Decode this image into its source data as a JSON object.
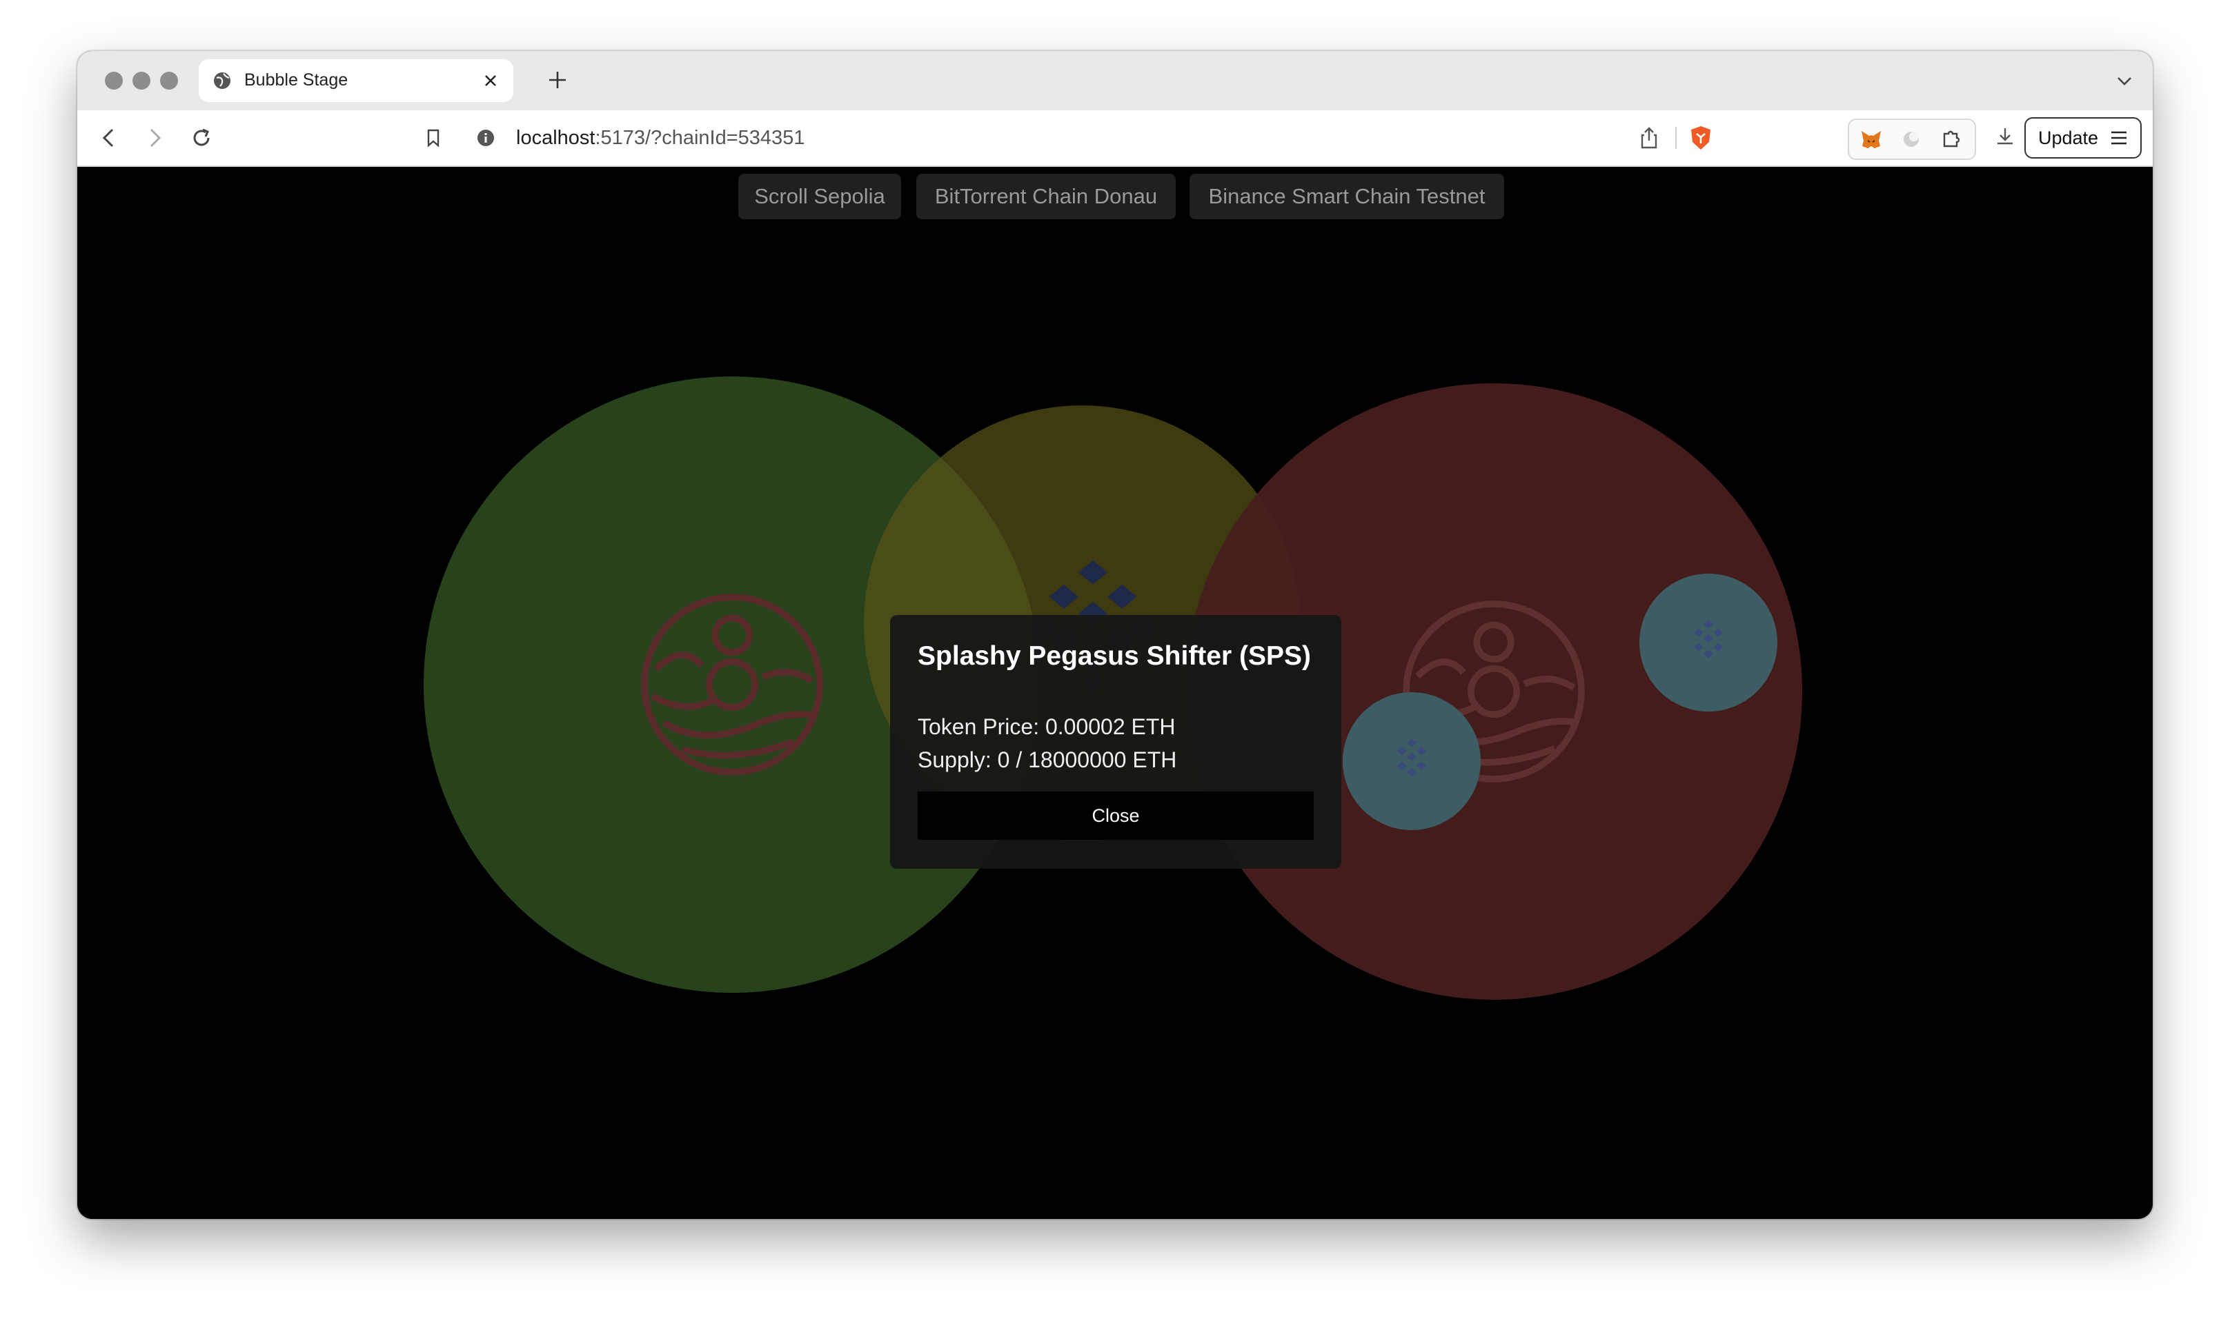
{
  "browser": {
    "tab_title": "Bubble Stage",
    "url_host": "localhost",
    "url_rest": ":5173/?chainId=534351",
    "update_label": "Update"
  },
  "chains": [
    "Scroll Sepolia",
    "BitTorrent Chain Donau",
    "Binance Smart Chain Testnet"
  ],
  "bubbles": [
    {
      "name": "green-bubble",
      "color": "#2e4b1f",
      "icon": "orbit-token-icon"
    },
    {
      "name": "olive-bubble",
      "color": "#4f4a16",
      "icon": "hash-token-icon"
    },
    {
      "name": "red-bubble",
      "color": "#471d1d",
      "icon": "orbit-token-icon"
    },
    {
      "name": "small-teal-bubble",
      "color": "#3d5c63",
      "icon": "hash-token-icon"
    },
    {
      "name": "small-teal-bubble-2",
      "color": "#3d5c63",
      "icon": "hash-token-icon"
    }
  ],
  "modal": {
    "title": "Splashy Pegasus Shifter (SPS)",
    "price": "Token Price: 0.00002 ETH",
    "supply": "Supply: 0 / 18000000 ETH",
    "close_label": "Close"
  }
}
